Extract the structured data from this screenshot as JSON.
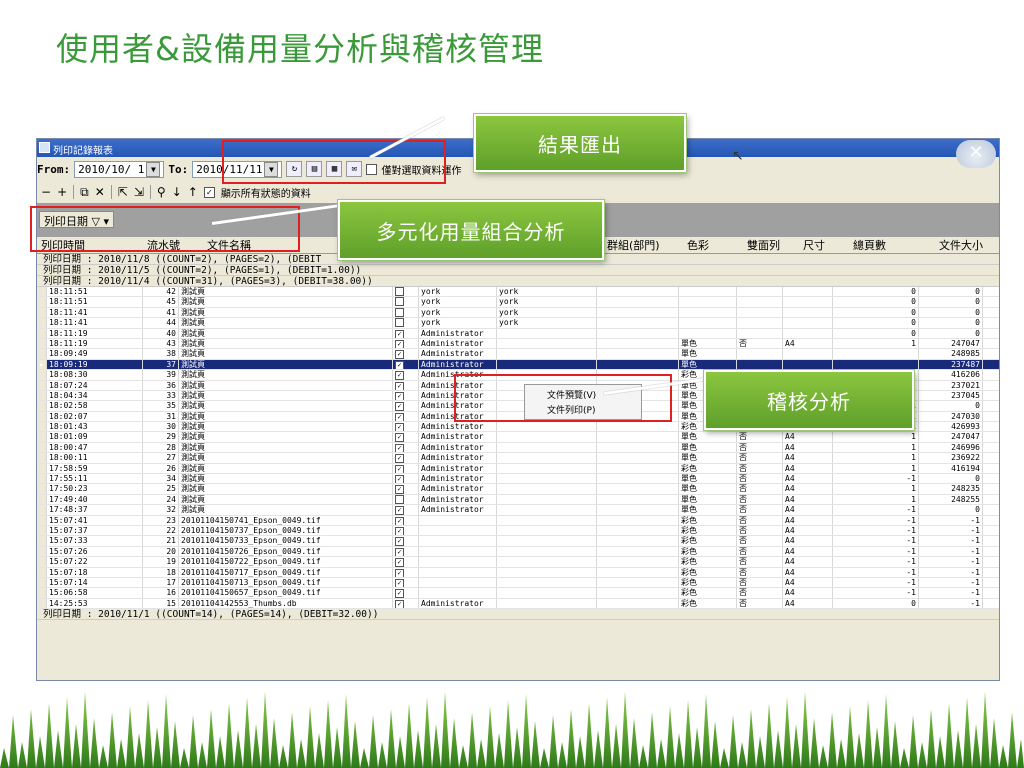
{
  "slide": {
    "title": "使用者&設備用量分析與稽核管理"
  },
  "window": {
    "title": "列印記錄報表",
    "from_label": "From:",
    "from_value": "2010/10/ 1",
    "to_label": "To:",
    "to_value": "2010/11/11",
    "only_selected_label": "僅對選取資料運作",
    "show_status_label": "顯示所有狀態的資料",
    "group_tag": "列印日期"
  },
  "headers": [
    "列印時間",
    "流水號",
    "文件名稱",
    "群組(部門)",
    "色彩",
    "雙面列",
    "尺寸",
    "總頁數",
    "文件大小"
  ],
  "groups": {
    "g1": "列印日期 : 2010/11/8 ((COUNT=2), (PAGES=2), (DEBIT",
    "g2": "列印日期 : 2010/11/5 ((COUNT=2), (PAGES=1), (DEBIT=1.00))",
    "g3": "列印日期 : 2010/11/4 ((COUNT=31), (PAGES=3), (DEBIT=38.00))",
    "g4": "列印日期 : 2010/11/1 ((COUNT=14), (PAGES=14), (DEBIT=32.00))"
  },
  "rows": [
    {
      "time": "18:11:51",
      "no": "42",
      "doc": "測試頁",
      "chk": false,
      "user": "york",
      "user2": "york",
      "color": "",
      "duplex": "",
      "size": "",
      "pages": "0",
      "bytes": "0"
    },
    {
      "time": "18:11:51",
      "no": "45",
      "doc": "測試頁",
      "chk": false,
      "user": "york",
      "user2": "york",
      "color": "",
      "duplex": "",
      "size": "",
      "pages": "0",
      "bytes": "0"
    },
    {
      "time": "18:11:41",
      "no": "41",
      "doc": "測試頁",
      "chk": false,
      "user": "york",
      "user2": "york",
      "color": "",
      "duplex": "",
      "size": "",
      "pages": "0",
      "bytes": "0"
    },
    {
      "time": "18:11:41",
      "no": "44",
      "doc": "測試頁",
      "chk": false,
      "user": "york",
      "user2": "york",
      "color": "",
      "duplex": "",
      "size": "",
      "pages": "0",
      "bytes": "0"
    },
    {
      "time": "18:11:19",
      "no": "40",
      "doc": "測試頁",
      "chk": true,
      "user": "Administrator",
      "user2": "",
      "color": "",
      "duplex": "",
      "size": "",
      "pages": "0",
      "bytes": "0"
    },
    {
      "time": "18:11:19",
      "no": "43",
      "doc": "測試頁",
      "chk": true,
      "user": "Administrator",
      "user2": "",
      "color": "單色",
      "duplex": "否",
      "size": "A4",
      "pages": "1",
      "bytes": "247047"
    },
    {
      "time": "18:09:49",
      "no": "38",
      "doc": "測試頁",
      "chk": true,
      "user": "Administrator",
      "user2": "",
      "color": "單色",
      "duplex": "",
      "size": "",
      "pages": "",
      "bytes": "248985"
    },
    {
      "time": "18:09:19",
      "no": "37",
      "doc": "測試頁",
      "chk": true,
      "user": "Administrator",
      "user2": "",
      "color": "單色",
      "duplex": "",
      "size": "",
      "pages": "",
      "bytes": "237487",
      "sel": true
    },
    {
      "time": "18:08:30",
      "no": "39",
      "doc": "測試頁",
      "chk": true,
      "user": "Administrator",
      "user2": "",
      "color": "彩色",
      "duplex": "",
      "size": "",
      "pages": "",
      "bytes": "416206"
    },
    {
      "time": "18:07:24",
      "no": "36",
      "doc": "測試頁",
      "chk": true,
      "user": "Administrator",
      "user2": "",
      "color": "單色",
      "duplex": "",
      "size": "",
      "pages": "",
      "bytes": "237021"
    },
    {
      "time": "18:04:34",
      "no": "33",
      "doc": "測試頁",
      "chk": true,
      "user": "Administrator",
      "user2": "",
      "color": "單色",
      "duplex": "",
      "size": "",
      "pages": "",
      "bytes": "237045"
    },
    {
      "time": "18:02:58",
      "no": "35",
      "doc": "測試頁",
      "chk": true,
      "user": "Administrator",
      "user2": "",
      "color": "單色",
      "duplex": "",
      "size": "A4",
      "pages": "-1",
      "bytes": "0"
    },
    {
      "time": "18:02:07",
      "no": "31",
      "doc": "測試頁",
      "chk": true,
      "user": "Administrator",
      "user2": "",
      "color": "單色",
      "duplex": "否",
      "size": "A4",
      "pages": "1",
      "bytes": "247030"
    },
    {
      "time": "18:01:43",
      "no": "30",
      "doc": "測試頁",
      "chk": true,
      "user": "Administrator",
      "user2": "",
      "color": "彩色",
      "duplex": "否",
      "size": "A4",
      "pages": "1",
      "bytes": "426993"
    },
    {
      "time": "18:01:09",
      "no": "29",
      "doc": "測試頁",
      "chk": true,
      "user": "Administrator",
      "user2": "",
      "color": "單色",
      "duplex": "否",
      "size": "A4",
      "pages": "1",
      "bytes": "247047"
    },
    {
      "time": "18:00:47",
      "no": "28",
      "doc": "測試頁",
      "chk": true,
      "user": "Administrator",
      "user2": "",
      "color": "單色",
      "duplex": "否",
      "size": "A4",
      "pages": "1",
      "bytes": "246996"
    },
    {
      "time": "18:00:11",
      "no": "27",
      "doc": "測試頁",
      "chk": true,
      "user": "Administrator",
      "user2": "",
      "color": "單色",
      "duplex": "否",
      "size": "A4",
      "pages": "1",
      "bytes": "236922"
    },
    {
      "time": "17:58:59",
      "no": "26",
      "doc": "測試頁",
      "chk": true,
      "user": "Administrator",
      "user2": "",
      "color": "彩色",
      "duplex": "否",
      "size": "A4",
      "pages": "1",
      "bytes": "416194"
    },
    {
      "time": "17:55:11",
      "no": "34",
      "doc": "測試頁",
      "chk": true,
      "user": "Administrator",
      "user2": "",
      "color": "單色",
      "duplex": "否",
      "size": "A4",
      "pages": "-1",
      "bytes": "0"
    },
    {
      "time": "17:50:23",
      "no": "25",
      "doc": "測試頁",
      "chk": true,
      "user": "Administrator",
      "user2": "",
      "color": "單色",
      "duplex": "否",
      "size": "A4",
      "pages": "1",
      "bytes": "248235"
    },
    {
      "time": "17:49:40",
      "no": "24",
      "doc": "測試頁",
      "chk": false,
      "user": "Administrator",
      "user2": "",
      "color": "單色",
      "duplex": "否",
      "size": "A4",
      "pages": "1",
      "bytes": "248255"
    },
    {
      "time": "17:48:37",
      "no": "32",
      "doc": "測試頁",
      "chk": true,
      "user": "Administrator",
      "user2": "",
      "color": "單色",
      "duplex": "否",
      "size": "A4",
      "pages": "-1",
      "bytes": "0"
    },
    {
      "time": "15:07:41",
      "no": "23",
      "doc": "20101104150741_Epson_0049.tif",
      "chk": true,
      "user": "",
      "user2": "",
      "color": "彩色",
      "duplex": "否",
      "size": "A4",
      "pages": "-1",
      "bytes": "-1"
    },
    {
      "time": "15:07:37",
      "no": "22",
      "doc": "20101104150737_Epson_0049.tif",
      "chk": true,
      "user": "",
      "user2": "",
      "color": "彩色",
      "duplex": "否",
      "size": "A4",
      "pages": "-1",
      "bytes": "-1"
    },
    {
      "time": "15:07:33",
      "no": "21",
      "doc": "20101104150733_Epson_0049.tif",
      "chk": true,
      "user": "",
      "user2": "",
      "color": "彩色",
      "duplex": "否",
      "size": "A4",
      "pages": "-1",
      "bytes": "-1"
    },
    {
      "time": "15:07:26",
      "no": "20",
      "doc": "20101104150726_Epson_0049.tif",
      "chk": true,
      "user": "",
      "user2": "",
      "color": "彩色",
      "duplex": "否",
      "size": "A4",
      "pages": "-1",
      "bytes": "-1"
    },
    {
      "time": "15:07:22",
      "no": "19",
      "doc": "20101104150722_Epson_0049.tif",
      "chk": true,
      "user": "",
      "user2": "",
      "color": "彩色",
      "duplex": "否",
      "size": "A4",
      "pages": "-1",
      "bytes": "-1"
    },
    {
      "time": "15:07:18",
      "no": "18",
      "doc": "20101104150717_Epson_0049.tif",
      "chk": true,
      "user": "",
      "user2": "",
      "color": "彩色",
      "duplex": "否",
      "size": "A4",
      "pages": "-1",
      "bytes": "-1"
    },
    {
      "time": "15:07:14",
      "no": "17",
      "doc": "20101104150713_Epson_0049.tif",
      "chk": true,
      "user": "",
      "user2": "",
      "color": "彩色",
      "duplex": "否",
      "size": "A4",
      "pages": "-1",
      "bytes": "-1"
    },
    {
      "time": "15:06:58",
      "no": "16",
      "doc": "20101104150657_Epson_0049.tif",
      "chk": true,
      "user": "",
      "user2": "",
      "color": "彩色",
      "duplex": "否",
      "size": "A4",
      "pages": "-1",
      "bytes": "-1"
    },
    {
      "time": "14:25:53",
      "no": "15",
      "doc": "20101104142553_Thumbs.db",
      "chk": true,
      "user": "Administrator",
      "user2": "",
      "color": "彩色",
      "duplex": "否",
      "size": "A4",
      "pages": "0",
      "bytes": "-1"
    }
  ],
  "context_menu": [
    "文件預覽(V)",
    "文件列印(P)"
  ],
  "callouts": {
    "export": "結果匯出",
    "multi": "多元化用量組合分析",
    "audit": "稽核分析"
  },
  "colors": {
    "title_green": "#3a9a3a",
    "callout_green": "#7bbd35",
    "highlight_red": "#e02020",
    "selected_row": "#1a2a7a"
  }
}
